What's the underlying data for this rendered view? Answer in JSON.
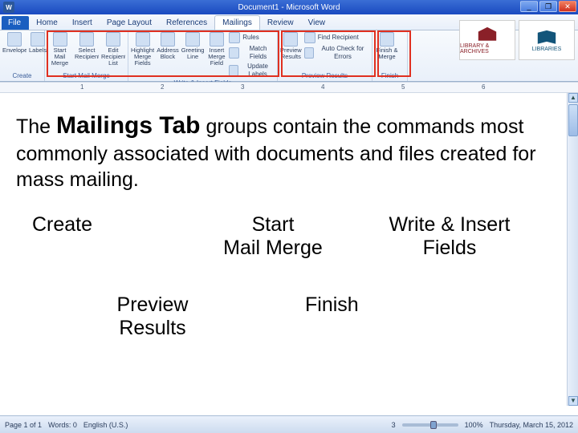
{
  "titlebar": {
    "title": "Document1 - Microsoft Word",
    "app_initial": "W",
    "min": "_",
    "max": "❐",
    "close": "✕"
  },
  "tabs": {
    "file": "File",
    "items": [
      "Home",
      "Insert",
      "Page Layout",
      "References",
      "Mailings",
      "Review",
      "View"
    ],
    "active_index": 4
  },
  "ribbon": {
    "groups": [
      {
        "label": "Create",
        "buttons": [
          "Envelopes",
          "Labels"
        ]
      },
      {
        "label": "Start Mail Merge",
        "buttons": [
          "Start Mail Merge",
          "Select Recipients",
          "Edit Recipient List"
        ]
      },
      {
        "label": "Write & Insert Fields",
        "buttons": [
          "Highlight Merge Fields",
          "Address Block",
          "Greeting Line",
          "Insert Merge Field"
        ],
        "side": [
          "Rules",
          "Match Fields",
          "Update Labels"
        ]
      },
      {
        "label": "Preview Results",
        "buttons": [
          "Preview Results"
        ],
        "side": [
          "Find Recipient",
          "Auto Check for Errors"
        ]
      },
      {
        "label": "Finish",
        "buttons": [
          "Finish & Merge"
        ]
      }
    ]
  },
  "logos": {
    "left_label": "LIBRARY & ARCHIVES",
    "right_label": "LIBRARIES"
  },
  "ruler": {
    "marks": [
      "1",
      "2",
      "3",
      "4",
      "5",
      "6"
    ]
  },
  "body": {
    "line1_prefix": "The ",
    "line1_strong": "Mailings Tab",
    "line1_rest": " groups contain the commands most commonly associated with documents and files created for mass mailing."
  },
  "group_labels": {
    "create": "Create",
    "start": "Start\nMail Merge",
    "write": "Write & Insert\nFields",
    "preview": "Preview\nResults",
    "finish": "Finish"
  },
  "status": {
    "page": "Page 1 of 1",
    "words": "Words: 0",
    "lang": "English (U.S.)",
    "zoom": "100%",
    "slide": "3",
    "date_hint": "Thursday, March 15, 2012"
  }
}
